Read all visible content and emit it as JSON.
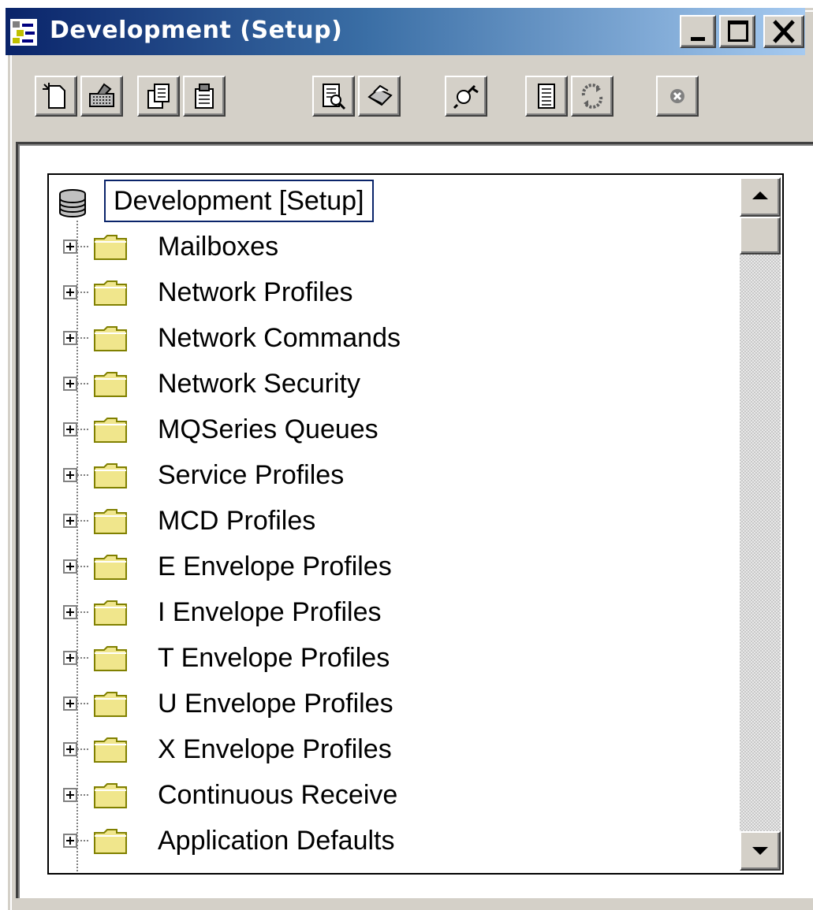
{
  "window": {
    "title": "Development (Setup)",
    "caption_buttons": [
      "minimize",
      "maximize",
      "close"
    ]
  },
  "toolbar": {
    "buttons": [
      {
        "name": "new-icon"
      },
      {
        "name": "keyboard-icon"
      },
      {
        "name": "copy-icon"
      },
      {
        "name": "paste-icon"
      },
      {
        "name": "print-preview-icon"
      },
      {
        "name": "printer-icon"
      },
      {
        "name": "find-icon"
      },
      {
        "name": "report-icon"
      },
      {
        "name": "refresh-icon"
      },
      {
        "name": "exit-icon"
      }
    ]
  },
  "tree": {
    "root_label": "Development [Setup]",
    "items": [
      {
        "label": "Mailboxes"
      },
      {
        "label": "Network Profiles"
      },
      {
        "label": "Network Commands"
      },
      {
        "label": "Network Security"
      },
      {
        "label": "MQSeries Queues"
      },
      {
        "label": "Service Profiles"
      },
      {
        "label": "MCD Profiles"
      },
      {
        "label": "E Envelope Profiles"
      },
      {
        "label": "I Envelope Profiles"
      },
      {
        "label": "T Envelope Profiles"
      },
      {
        "label": "U Envelope Profiles"
      },
      {
        "label": "X Envelope Profiles"
      },
      {
        "label": "Continuous Receive"
      },
      {
        "label": "Application Defaults"
      }
    ]
  },
  "colors": {
    "titlebar_start": "#0a246a",
    "titlebar_end": "#a6caf0",
    "face": "#d4d0c8",
    "folder": "#f0e68c"
  }
}
